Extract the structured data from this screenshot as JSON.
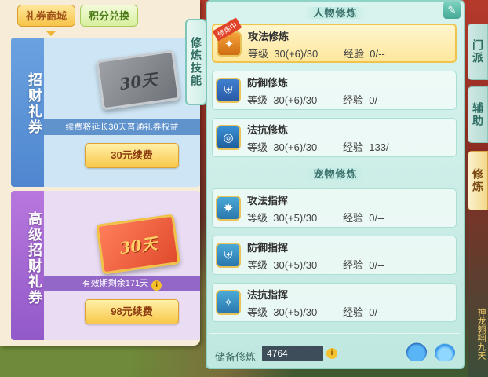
{
  "shop": {
    "tabs": [
      {
        "label": "礼券商城",
        "active": true
      },
      {
        "label": "积分兑换",
        "active": false
      }
    ],
    "cards": [
      {
        "side_label": "招财礼券",
        "ticket_text": "30天",
        "info": "续费将延长30天普通礼券权益",
        "button": "30元续费"
      },
      {
        "side_label": "高级招财礼券",
        "ticket_text": "30天",
        "info": "有效期剩余171天",
        "button": "98元续费"
      }
    ]
  },
  "cultivation": {
    "vertical_tab": "修炼技能",
    "section_character": "人物修炼",
    "section_pet": "宠物修炼",
    "level_label": "等级",
    "exp_label": "经验",
    "character_skills": [
      {
        "name": "攻法修炼",
        "level": "30(+6)/30",
        "exp": "0/--",
        "badge": "修炼中",
        "icon": "paw-attack-icon"
      },
      {
        "name": "防御修炼",
        "level": "30(+6)/30",
        "exp": "0/--",
        "icon": "shield-icon"
      },
      {
        "name": "法抗修炼",
        "level": "30(+6)/30",
        "exp": "133/--",
        "icon": "swirl-shield-icon"
      }
    ],
    "pet_skills": [
      {
        "name": "攻法指挥",
        "level": "30(+5)/30",
        "exp": "0/--",
        "icon": "pet-claw-icon"
      },
      {
        "name": "防御指挥",
        "level": "30(+5)/30",
        "exp": "0/--",
        "icon": "pet-shield-icon"
      },
      {
        "name": "法抗指挥",
        "level": "30(+5)/30",
        "exp": "0/--",
        "icon": "pet-magic-icon"
      }
    ],
    "reserve_label": "储备修炼",
    "reserve_value": "4764"
  },
  "side_tabs": [
    {
      "label": "门派",
      "active": false
    },
    {
      "label": "辅助",
      "active": false
    },
    {
      "label": "修炼",
      "active": true
    }
  ],
  "scene_text": "神龙翱翔九天",
  "colors": {
    "accent_gold": "#f8c84a",
    "panel_teal": "#bfe8e0",
    "card_blue": "#4f86cf",
    "card_purple": "#9259c9"
  }
}
